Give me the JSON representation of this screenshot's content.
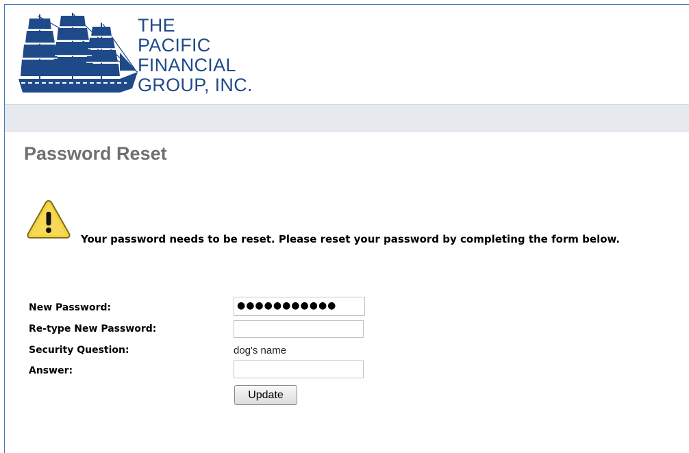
{
  "brand": {
    "logo_lines": [
      "THE",
      "PACIFIC",
      "FINANCIAL",
      "GROUP, INC."
    ]
  },
  "page": {
    "title": "Password Reset",
    "alert_message": "Your password needs to be reset. Please reset your password by completing the form below."
  },
  "form": {
    "new_password_label": "New Password:",
    "new_password_value": "●●●●●●●●●●●",
    "retype_password_label": "Re-type New Password:",
    "retype_password_value": "",
    "security_question_label": "Security Question:",
    "security_question_value": "dog's name",
    "answer_label": "Answer:",
    "answer_value": "",
    "update_label": "Update"
  },
  "colors": {
    "brand_blue": "#1f4a8a",
    "title_gray": "#707070",
    "nav_bar": "#e6e9ee",
    "warning_yellow": "#f3d23a"
  },
  "icons": {
    "logo": "sailing-ship-logo",
    "alert": "warning-triangle-icon"
  }
}
